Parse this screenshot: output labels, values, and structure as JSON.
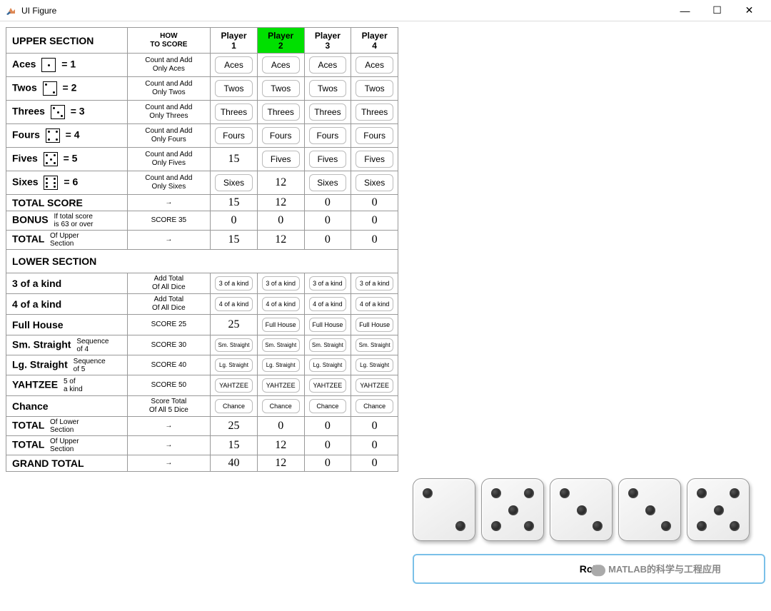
{
  "window": {
    "title": "UI Figure"
  },
  "headers": {
    "upper": "UPPER SECTION",
    "how": "HOW\nTO SCORE",
    "lower": "LOWER SECTION"
  },
  "players": [
    "Player\n1",
    "Player\n2",
    "Player\n3",
    "Player\n4"
  ],
  "active_player_index": 1,
  "upper_rows": [
    {
      "label": "Aces",
      "suffix": "= 1",
      "die": 1,
      "how": "Count and Add\nOnly Aces",
      "cells": [
        "Aces",
        "Aces",
        "Aces",
        "Aces"
      ],
      "types": [
        "btn",
        "btn",
        "btn",
        "btn"
      ]
    },
    {
      "label": "Twos",
      "suffix": "= 2",
      "die": 2,
      "how": "Count and Add\nOnly Twos",
      "cells": [
        "Twos",
        "Twos",
        "Twos",
        "Twos"
      ],
      "types": [
        "btn",
        "btn",
        "btn",
        "btn"
      ]
    },
    {
      "label": "Threes",
      "suffix": "= 3",
      "die": 3,
      "how": "Count and Add\nOnly Threes",
      "cells": [
        "Threes",
        "Threes",
        "Threes",
        "Threes"
      ],
      "types": [
        "btn",
        "btn",
        "btn",
        "btn"
      ]
    },
    {
      "label": "Fours",
      "suffix": "= 4",
      "die": 4,
      "how": "Count and Add\nOnly Fours",
      "cells": [
        "Fours",
        "Fours",
        "Fours",
        "Fours"
      ],
      "types": [
        "btn",
        "btn",
        "btn",
        "btn"
      ]
    },
    {
      "label": "Fives",
      "suffix": "= 5",
      "die": 5,
      "how": "Count and Add\nOnly Fives",
      "cells": [
        "15",
        "Fives",
        "Fives",
        "Fives"
      ],
      "types": [
        "val",
        "btn",
        "btn",
        "btn"
      ]
    },
    {
      "label": "Sixes",
      "suffix": "= 6",
      "die": 6,
      "how": "Count and Add\nOnly Sixes",
      "cells": [
        "Sixes",
        "12",
        "Sixes",
        "Sixes"
      ],
      "types": [
        "btn",
        "val",
        "btn",
        "btn"
      ]
    }
  ],
  "upper_totals": [
    {
      "label": "TOTAL SCORE",
      "sub": "",
      "how": "→",
      "cells": [
        "15",
        "12",
        "0",
        "0"
      ]
    },
    {
      "label": "BONUS",
      "sub": "If total score\nis 63 or over",
      "how": "SCORE 35",
      "cells": [
        "0",
        "0",
        "0",
        "0"
      ]
    },
    {
      "label": "TOTAL",
      "sub": "Of Upper\nSection",
      "how": "→",
      "cells": [
        "15",
        "12",
        "0",
        "0"
      ]
    }
  ],
  "lower_rows": [
    {
      "label": "3 of a kind",
      "sub": "",
      "how": "Add Total\nOf All Dice",
      "cells": [
        "3 of a kind",
        "3 of a kind",
        "3 of a kind",
        "3 of a kind"
      ],
      "types": [
        "btn",
        "btn",
        "btn",
        "btn"
      ],
      "size": "small"
    },
    {
      "label": "4 of a kind",
      "sub": "",
      "how": "Add Total\nOf All Dice",
      "cells": [
        "4 of a kind",
        "4 of a kind",
        "4 of a kind",
        "4 of a kind"
      ],
      "types": [
        "btn",
        "btn",
        "btn",
        "btn"
      ],
      "size": "small"
    },
    {
      "label": "Full House",
      "sub": "",
      "how": "SCORE 25",
      "cells": [
        "25",
        "Full House",
        "Full House",
        "Full House"
      ],
      "types": [
        "val",
        "btn",
        "btn",
        "btn"
      ],
      "size": "small"
    },
    {
      "label": "Sm. Straight",
      "sub": "Sequence\nof 4",
      "how": "SCORE 30",
      "cells": [
        "Sm. Straight",
        "Sm. Straight",
        "Sm. Straight",
        "Sm. Straight"
      ],
      "types": [
        "btn",
        "btn",
        "btn",
        "btn"
      ],
      "size": "xsmall"
    },
    {
      "label": "Lg. Straight",
      "sub": "Sequence\nof 5",
      "how": "SCORE 40",
      "cells": [
        "Lg. Straight",
        "Lg. Straight",
        "Lg. Straight",
        "Lg. Straight"
      ],
      "types": [
        "btn",
        "btn",
        "btn",
        "btn"
      ],
      "size": "xsmall"
    },
    {
      "label": "YAHTZEE",
      "sub": "5 of\na kind",
      "how": "SCORE 50",
      "cells": [
        "YAHTZEE",
        "YAHTZEE",
        "YAHTZEE",
        "YAHTZEE"
      ],
      "types": [
        "btn",
        "btn",
        "btn",
        "btn"
      ],
      "size": "small"
    },
    {
      "label": "Chance",
      "sub": "",
      "how": "Score Total\nOf All 5 Dice",
      "cells": [
        "Chance",
        "Chance",
        "Chance",
        "Chance"
      ],
      "types": [
        "btn",
        "btn",
        "btn",
        "btn"
      ],
      "size": "small"
    }
  ],
  "lower_totals": [
    {
      "label": "TOTAL",
      "sub": "Of Lower\nSection",
      "how": "→",
      "cells": [
        "25",
        "0",
        "0",
        "0"
      ]
    },
    {
      "label": "TOTAL",
      "sub": "Of Upper\nSection",
      "how": "→",
      "cells": [
        "15",
        "12",
        "0",
        "0"
      ]
    },
    {
      "label": "GRAND TOTAL",
      "sub": "",
      "how": "→",
      "cells": [
        "40",
        "12",
        "0",
        "0"
      ]
    }
  ],
  "dice": [
    2,
    5,
    3,
    3,
    5
  ],
  "roll_button": "Roll",
  "watermark": "MATLAB的科学与工程应用"
}
